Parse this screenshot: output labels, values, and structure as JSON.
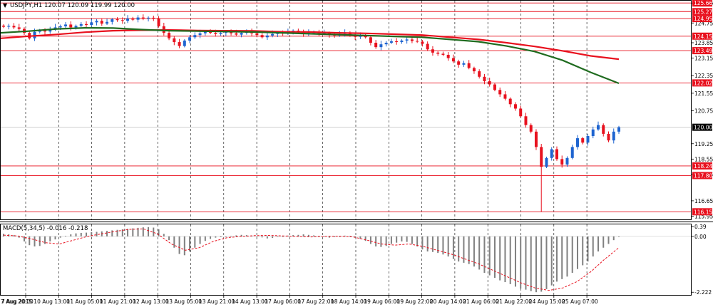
{
  "header": {
    "symbol_line": "USDJPY,H1  120.07 120.09 119.99 120.00",
    "indicator_line": "MACD(5,34,5) -0.016 -0.218"
  },
  "colors": {
    "bull": "#1e64d0",
    "bear": "#e8111e",
    "ma_fast": "#e8111e",
    "ma_slow": "#1f6b1f",
    "level_line": "#e8111e",
    "macd_hist": "#808080",
    "macd_signal": "#e8111e",
    "grid": "#000000",
    "current_price_bg": "#000000"
  },
  "chart_data": [
    {
      "type": "candlestick",
      "title": "USDJPY,H1",
      "ohlc_last": {
        "open": 120.07,
        "high": 120.09,
        "low": 119.99,
        "close": 120.0
      },
      "ylim": [
        115.9,
        125.7
      ],
      "grid": true,
      "y_tick_labels": [
        "125.66",
        "124.75",
        "123.85",
        "123.15",
        "122.35",
        "121.55",
        "120.75",
        "119.25",
        "118.55",
        "117.85",
        "116.65",
        "115.95"
      ],
      "x_tick_labels": [
        "7 Aug 2015",
        "7 Aug 20:00",
        "10 Aug 13:00",
        "11 Aug 05:00",
        "11 Aug 21:00",
        "12 Aug 13:00",
        "13 Aug 05:00",
        "13 Aug 21:00",
        "14 Aug 13:00",
        "17 Aug 06:00",
        "17 Aug 22:00",
        "18 Aug 14:00",
        "19 Aug 06:00",
        "19 Aug 22:00",
        "20 Aug 14:00",
        "21 Aug 06:00",
        "21 Aug 22:00",
        "24 Aug 15:00",
        "25 Aug 07:00"
      ],
      "current_price": "120.00",
      "price_levels": [
        "125.27",
        "124.95",
        "124.15",
        "123.49",
        "122.02",
        "118.24",
        "117.80",
        "116.15"
      ],
      "close_series": [
        124.58,
        124.62,
        124.55,
        124.48,
        124.3,
        124.05,
        124.35,
        124.42,
        124.36,
        124.45,
        124.55,
        124.6,
        124.68,
        124.55,
        124.62,
        124.7,
        124.66,
        124.78,
        124.85,
        124.72,
        124.8,
        124.92,
        124.88,
        124.85,
        124.95,
        124.9,
        125.0,
        124.96,
        124.99,
        124.94,
        124.6,
        124.3,
        124.05,
        123.88,
        123.7,
        123.95,
        124.1,
        124.2,
        124.28,
        124.35,
        124.3,
        124.25,
        124.3,
        124.33,
        124.28,
        124.22,
        124.3,
        124.35,
        124.28,
        124.2,
        124.1,
        124.18,
        124.25,
        124.3,
        124.27,
        124.35,
        124.4,
        124.32,
        124.26,
        124.3,
        124.33,
        124.28,
        124.3,
        124.22,
        124.18,
        124.25,
        124.3,
        124.2,
        124.12,
        124.18,
        124.1,
        123.85,
        123.65,
        123.78,
        123.85,
        123.92,
        123.88,
        123.95,
        124.0,
        123.93,
        123.9,
        123.8,
        123.55,
        123.4,
        123.35,
        123.3,
        123.15,
        123.0,
        122.85,
        122.92,
        122.7,
        122.55,
        122.3,
        122.1,
        121.95,
        121.7,
        121.5,
        121.3,
        121.05,
        120.85,
        120.5,
        120.1,
        119.8,
        119.1,
        118.2,
        118.6,
        119.0,
        118.55,
        118.3,
        118.6,
        119.1,
        119.5,
        119.3,
        119.6,
        119.9,
        120.1,
        119.7,
        119.4,
        119.8,
        120.0
      ],
      "ma_fast_series": [
        124.05,
        124.15,
        124.23,
        124.33,
        124.4,
        124.42,
        124.43,
        124.41,
        124.4,
        124.39,
        124.35,
        124.34,
        124.3,
        124.28,
        124.24,
        124.2,
        124.1,
        124.0,
        123.85,
        123.68,
        123.48,
        123.25,
        123.1
      ],
      "ma_slow_series": [
        124.3,
        124.38,
        124.48,
        124.53,
        124.52,
        124.45,
        124.4,
        124.38,
        124.36,
        124.34,
        124.3,
        124.26,
        124.22,
        124.18,
        124.14,
        124.1,
        124.0,
        123.9,
        123.7,
        123.45,
        123.05,
        122.5,
        122.0
      ]
    },
    {
      "type": "bar",
      "title": "MACD(5,34,5) -0.016 -0.218",
      "ylim": [
        -2.3,
        0.45
      ],
      "y_tick_labels": [
        "0.39",
        "0.00",
        "-2.222"
      ],
      "values": [
        0.1,
        0.08,
        0.05,
        -0.05,
        -0.2,
        -0.35,
        -0.4,
        -0.38,
        -0.3,
        -0.2,
        -0.12,
        -0.05,
        0.02,
        0.08,
        0.12,
        0.14,
        0.15,
        0.17,
        0.18,
        0.2,
        0.22,
        0.24,
        0.26,
        0.28,
        0.3,
        0.32,
        0.34,
        0.36,
        0.37,
        0.35,
        0.28,
        0.1,
        -0.15,
        -0.45,
        -0.7,
        -0.75,
        -0.6,
        -0.45,
        -0.3,
        -0.18,
        -0.1,
        -0.05,
        -0.03,
        -0.02,
        0.02,
        0.04,
        0.06,
        0.05,
        0.03,
        0.0,
        -0.04,
        -0.08,
        -0.06,
        -0.02,
        0.0,
        0.03,
        0.05,
        0.06,
        0.08,
        0.06,
        0.04,
        0.02,
        -0.02,
        -0.05,
        -0.03,
        0.0,
        0.03,
        0.02,
        -0.05,
        -0.1,
        -0.18,
        -0.3,
        -0.4,
        -0.42,
        -0.38,
        -0.3,
        -0.25,
        -0.2,
        -0.22,
        -0.3,
        -0.4,
        -0.52,
        -0.6,
        -0.62,
        -0.66,
        -0.72,
        -0.8,
        -0.9,
        -1.0,
        -1.05,
        -1.1,
        -1.2,
        -1.32,
        -1.45,
        -1.55,
        -1.65,
        -1.75,
        -1.82,
        -1.9,
        -2.0,
        -2.08,
        -2.12,
        -2.18,
        -2.22,
        -2.2,
        -2.1,
        -1.95,
        -1.8,
        -1.7,
        -1.6,
        -1.45,
        -1.3,
        -1.15,
        -1.0,
        -0.8,
        -0.6,
        -0.45,
        -0.3,
        -0.15,
        -0.02
      ],
      "signal_series": [
        0.05,
        0.02,
        -0.1,
        -0.25,
        -0.3,
        -0.15,
        0.0,
        0.1,
        0.2,
        0.28,
        0.3,
        0.1,
        -0.3,
        -0.55,
        -0.45,
        -0.2,
        -0.05,
        0.0,
        0.03,
        0.04,
        0.02,
        0.0,
        -0.02,
        0.0,
        0.01,
        -0.02,
        -0.15,
        -0.3,
        -0.35,
        -0.3,
        -0.4,
        -0.55,
        -0.7,
        -0.9,
        -1.1,
        -1.35,
        -1.6,
        -1.85,
        -2.05,
        -2.15,
        -2.05,
        -1.8,
        -1.4,
        -0.9,
        -0.45
      ]
    }
  ]
}
